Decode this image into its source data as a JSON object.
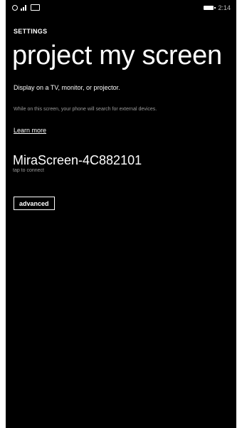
{
  "status_bar": {
    "time": "2:14",
    "icons": [
      "location-icon",
      "signal-icon",
      "message-icon",
      "battery-icon"
    ]
  },
  "header": {
    "section": "SETTINGS",
    "title": "project my screen"
  },
  "content": {
    "description": "Display on a TV, monitor, or projector.",
    "hint": "While on this screen, your phone will search for external devices.",
    "learn_more": "Learn more"
  },
  "device": {
    "name": "MiraScreen-4C882101",
    "subtitle": "tap to connect"
  },
  "buttons": {
    "advanced": "advanced"
  },
  "colors": {
    "background": "#000000",
    "text": "#ffffff",
    "secondary_text": "#9a9a9a"
  }
}
